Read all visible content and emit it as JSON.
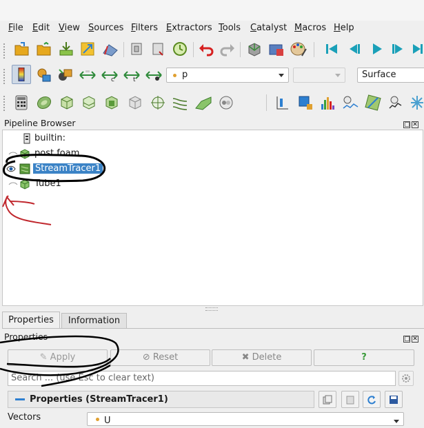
{
  "menu": [
    {
      "label": "File",
      "u": "F",
      "rest": "ile"
    },
    {
      "label": "Edit",
      "u": "E",
      "rest": "dit"
    },
    {
      "label": "View",
      "u": "V",
      "rest": "iew"
    },
    {
      "label": "Sources",
      "u": "S",
      "rest": "ources"
    },
    {
      "label": "Filters",
      "u": "F",
      "rest": "ilters"
    },
    {
      "label": "Extractors",
      "u": "E",
      "rest": "xtractors"
    },
    {
      "label": "Tools",
      "u": "T",
      "rest": "ools"
    },
    {
      "label": "Catalyst",
      "u": "C",
      "rest": "atalyst"
    },
    {
      "label": "Macros",
      "u": "M",
      "rest": "acros"
    },
    {
      "label": "Help",
      "u": "H",
      "rest": "elp"
    }
  ],
  "toolbar2": {
    "variable_combo": "p",
    "variable_icon": "point-data-icon",
    "component_combo": "",
    "representation_combo": "Surface"
  },
  "pipeline_browser": {
    "title": "Pipeline Browser",
    "items": [
      {
        "label": "builtin:",
        "icon": "server-icon"
      },
      {
        "label": "post.foam",
        "icon": "cube-icon"
      },
      {
        "label": "StreamTracer1",
        "icon": "stream-tracer-icon",
        "selected": true
      },
      {
        "label": "Tube1",
        "icon": "cube-icon"
      }
    ]
  },
  "tabs": {
    "properties": "Properties",
    "information": "Information"
  },
  "properties_panel": {
    "title": "Properties",
    "apply_label": "Apply",
    "reset_label": "Reset",
    "delete_label": "Delete",
    "help_label": "?",
    "search_placeholder": "Search ... (use Esc to clear text)",
    "section_title": "Properties (StreamTracer1)",
    "vectors_label": "Vectors",
    "vectors_value": "U"
  },
  "colors": {
    "selection": "#3b83c6",
    "annotation_black": "#000000",
    "annotation_red": "#c0272d"
  }
}
